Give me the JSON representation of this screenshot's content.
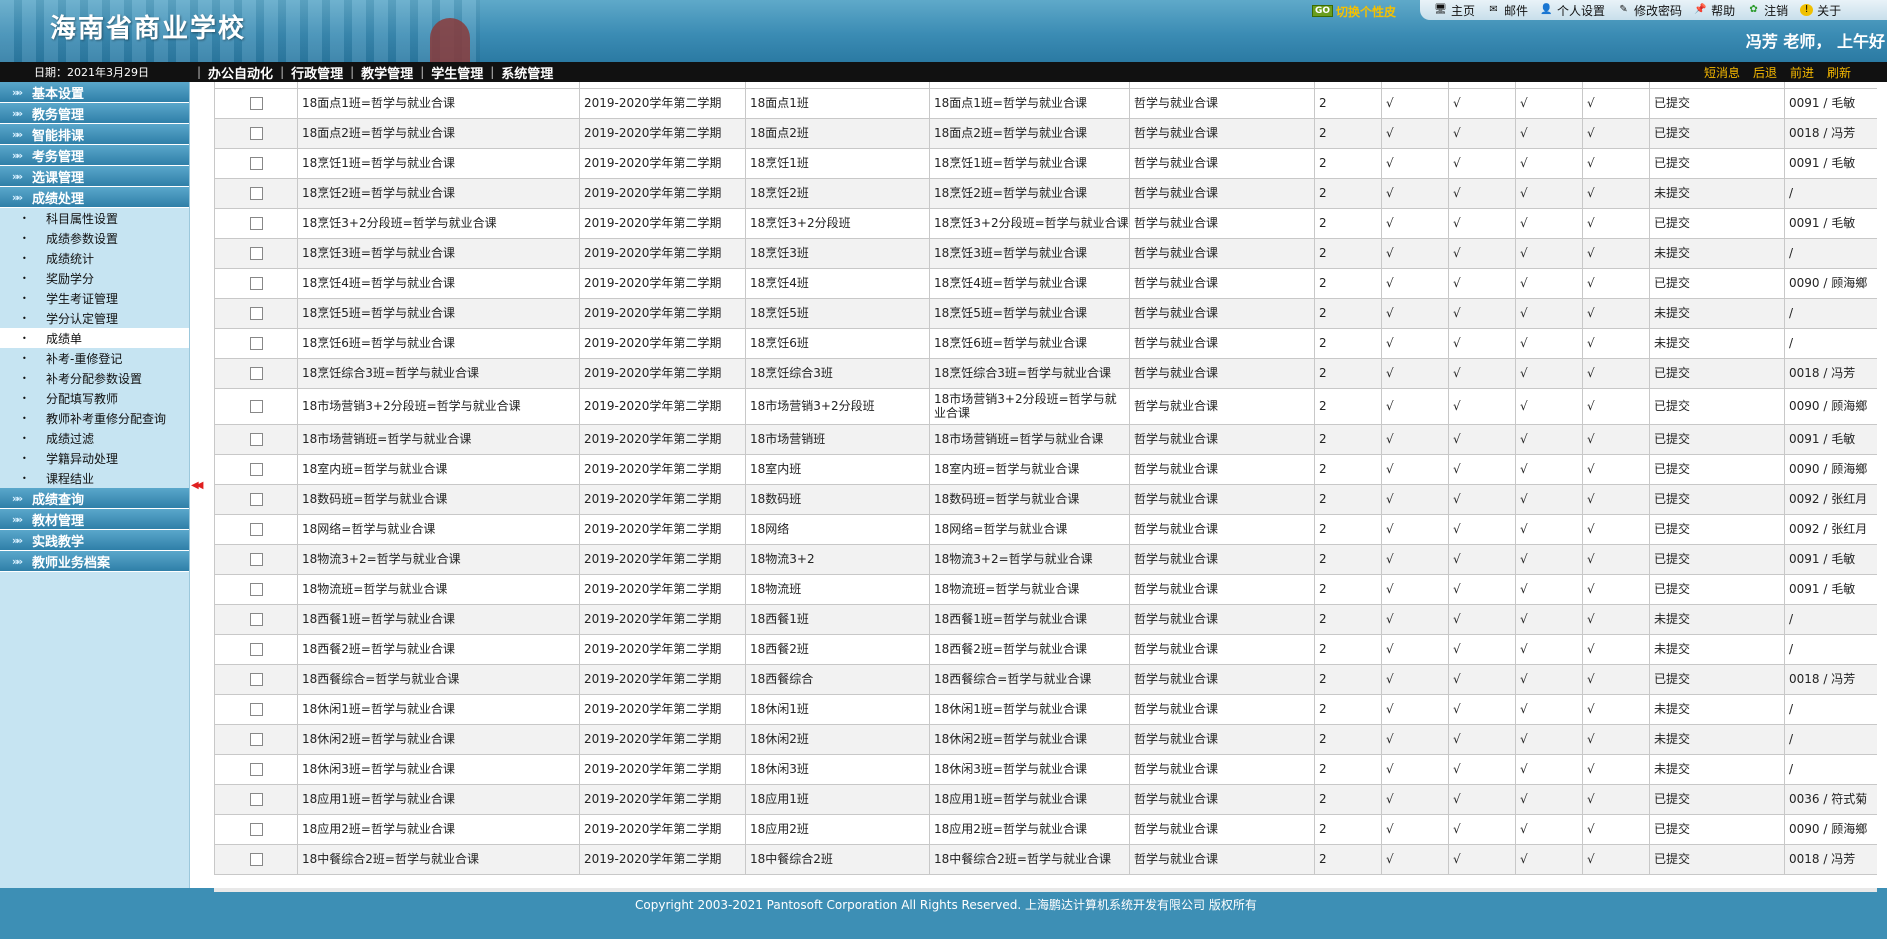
{
  "header": {
    "school_title": "海南省商业学校",
    "skin_button": "切换个性皮",
    "skin_go": "GO",
    "nav": [
      {
        "label": "主页",
        "icon": "monitor-icon"
      },
      {
        "label": "邮件",
        "icon": "mail-icon"
      },
      {
        "label": "个人设置",
        "icon": "user-icon"
      },
      {
        "label": "修改密码",
        "icon": "password-icon"
      },
      {
        "label": "帮助",
        "icon": "help-pin-icon"
      },
      {
        "label": "注销",
        "icon": "logout-icon"
      },
      {
        "label": "关于",
        "icon": "info-icon"
      }
    ],
    "greeting": "冯芳 老师， 上午好"
  },
  "menubar": {
    "date": "日期：2021年3月29日",
    "menus": [
      "办公自动化",
      "行政管理",
      "教学管理",
      "学生管理",
      "系统管理"
    ],
    "right": [
      "短消息",
      "后退",
      "前进",
      "刷新"
    ]
  },
  "sidebar": {
    "groups_top": [
      "基本设置",
      "教务管理",
      "智能排课",
      "考务管理",
      "选课管理",
      "成绩处理"
    ],
    "subitems": [
      "科目属性设置",
      "成绩参数设置",
      "成绩统计",
      "奖励学分",
      "学生考证管理",
      "学分认定管理",
      "成绩单",
      "补考-重修登记",
      "补考分配参数设置",
      "分配填写教师",
      "教师补考重修分配查询",
      "成绩过滤",
      "学籍异动处理",
      "课程结业"
    ],
    "active_subitem": "成绩单",
    "groups_bottom": [
      "成绩查询",
      "教材管理",
      "实践教学",
      "教师业务档案"
    ]
  },
  "table": {
    "rows": [
      {
        "name": "18面点1班=哲学与就业合课",
        "term": "2019-2020学年第二学期",
        "cls": "18面点1班",
        "course": "18面点1班=哲学与就业合课",
        "subject": "哲学与就业合课",
        "credit": "2",
        "m1": "√",
        "m2": "√",
        "m3": "√",
        "m4": "√",
        "status": "已提交",
        "teacher": "0091 / 毛敏"
      },
      {
        "name": "18面点2班=哲学与就业合课",
        "term": "2019-2020学年第二学期",
        "cls": "18面点2班",
        "course": "18面点2班=哲学与就业合课",
        "subject": "哲学与就业合课",
        "credit": "2",
        "m1": "√",
        "m2": "√",
        "m3": "√",
        "m4": "√",
        "status": "已提交",
        "teacher": "0018 / 冯芳"
      },
      {
        "name": "18烹饪1班=哲学与就业合课",
        "term": "2019-2020学年第二学期",
        "cls": "18烹饪1班",
        "course": "18烹饪1班=哲学与就业合课",
        "subject": "哲学与就业合课",
        "credit": "2",
        "m1": "√",
        "m2": "√",
        "m3": "√",
        "m4": "√",
        "status": "已提交",
        "teacher": "0091 / 毛敏"
      },
      {
        "name": "18烹饪2班=哲学与就业合课",
        "term": "2019-2020学年第二学期",
        "cls": "18烹饪2班",
        "course": "18烹饪2班=哲学与就业合课",
        "subject": "哲学与就业合课",
        "credit": "2",
        "m1": "√",
        "m2": "√",
        "m3": "√",
        "m4": "√",
        "status": "未提交",
        "teacher": "/"
      },
      {
        "name": "18烹饪3+2分段班=哲学与就业合课",
        "term": "2019-2020学年第二学期",
        "cls": "18烹饪3+2分段班",
        "course": "18烹饪3+2分段班=哲学与就业合课",
        "subject": "哲学与就业合课",
        "credit": "2",
        "m1": "√",
        "m2": "√",
        "m3": "√",
        "m4": "√",
        "status": "已提交",
        "teacher": "0091 / 毛敏"
      },
      {
        "name": "18烹饪3班=哲学与就业合课",
        "term": "2019-2020学年第二学期",
        "cls": "18烹饪3班",
        "course": "18烹饪3班=哲学与就业合课",
        "subject": "哲学与就业合课",
        "credit": "2",
        "m1": "√",
        "m2": "√",
        "m3": "√",
        "m4": "√",
        "status": "未提交",
        "teacher": "/"
      },
      {
        "name": "18烹饪4班=哲学与就业合课",
        "term": "2019-2020学年第二学期",
        "cls": "18烹饪4班",
        "course": "18烹饪4班=哲学与就业合课",
        "subject": "哲学与就业合课",
        "credit": "2",
        "m1": "√",
        "m2": "√",
        "m3": "√",
        "m4": "√",
        "status": "已提交",
        "teacher": "0090 / 顾海鄉"
      },
      {
        "name": "18烹饪5班=哲学与就业合课",
        "term": "2019-2020学年第二学期",
        "cls": "18烹饪5班",
        "course": "18烹饪5班=哲学与就业合课",
        "subject": "哲学与就业合课",
        "credit": "2",
        "m1": "√",
        "m2": "√",
        "m3": "√",
        "m4": "√",
        "status": "未提交",
        "teacher": "/"
      },
      {
        "name": "18烹饪6班=哲学与就业合课",
        "term": "2019-2020学年第二学期",
        "cls": "18烹饪6班",
        "course": "18烹饪6班=哲学与就业合课",
        "subject": "哲学与就业合课",
        "credit": "2",
        "m1": "√",
        "m2": "√",
        "m3": "√",
        "m4": "√",
        "status": "未提交",
        "teacher": "/"
      },
      {
        "name": "18烹饪综合3班=哲学与就业合课",
        "term": "2019-2020学年第二学期",
        "cls": "18烹饪综合3班",
        "course": "18烹饪综合3班=哲学与就业合课",
        "subject": "哲学与就业合课",
        "credit": "2",
        "m1": "√",
        "m2": "√",
        "m3": "√",
        "m4": "√",
        "status": "已提交",
        "teacher": "0018 / 冯芳"
      },
      {
        "name": "18市场营销3+2分段班=哲学与就业合课",
        "term": "2019-2020学年第二学期",
        "cls": "18市场营销3+2分段班",
        "course": "18市场营销3+2分段班=哲学与就业合课",
        "subject": "哲学与就业合课",
        "credit": "2",
        "m1": "√",
        "m2": "√",
        "m3": "√",
        "m4": "√",
        "status": "已提交",
        "teacher": "0090 / 顾海鄉",
        "tall": true
      },
      {
        "name": "18市场营销班=哲学与就业合课",
        "term": "2019-2020学年第二学期",
        "cls": "18市场营销班",
        "course": "18市场营销班=哲学与就业合课",
        "subject": "哲学与就业合课",
        "credit": "2",
        "m1": "√",
        "m2": "√",
        "m3": "√",
        "m4": "√",
        "status": "已提交",
        "teacher": "0091 / 毛敏"
      },
      {
        "name": "18室内班=哲学与就业合课",
        "term": "2019-2020学年第二学期",
        "cls": "18室内班",
        "course": "18室内班=哲学与就业合课",
        "subject": "哲学与就业合课",
        "credit": "2",
        "m1": "√",
        "m2": "√",
        "m3": "√",
        "m4": "√",
        "status": "已提交",
        "teacher": "0090 / 顾海鄉"
      },
      {
        "name": "18数码班=哲学与就业合课",
        "term": "2019-2020学年第二学期",
        "cls": "18数码班",
        "course": "18数码班=哲学与就业合课",
        "subject": "哲学与就业合课",
        "credit": "2",
        "m1": "√",
        "m2": "√",
        "m3": "√",
        "m4": "√",
        "status": "已提交",
        "teacher": "0092 / 张红月"
      },
      {
        "name": "18网络=哲学与就业合课",
        "term": "2019-2020学年第二学期",
        "cls": "18网络",
        "course": "18网络=哲学与就业合课",
        "subject": "哲学与就业合课",
        "credit": "2",
        "m1": "√",
        "m2": "√",
        "m3": "√",
        "m4": "√",
        "status": "已提交",
        "teacher": "0092 / 张红月"
      },
      {
        "name": "18物流3+2=哲学与就业合课",
        "term": "2019-2020学年第二学期",
        "cls": "18物流3+2",
        "course": "18物流3+2=哲学与就业合课",
        "subject": "哲学与就业合课",
        "credit": "2",
        "m1": "√",
        "m2": "√",
        "m3": "√",
        "m4": "√",
        "status": "已提交",
        "teacher": "0091 / 毛敏"
      },
      {
        "name": "18物流班=哲学与就业合课",
        "term": "2019-2020学年第二学期",
        "cls": "18物流班",
        "course": "18物流班=哲学与就业合课",
        "subject": "哲学与就业合课",
        "credit": "2",
        "m1": "√",
        "m2": "√",
        "m3": "√",
        "m4": "√",
        "status": "已提交",
        "teacher": "0091 / 毛敏"
      },
      {
        "name": "18西餐1班=哲学与就业合课",
        "term": "2019-2020学年第二学期",
        "cls": "18西餐1班",
        "course": "18西餐1班=哲学与就业合课",
        "subject": "哲学与就业合课",
        "credit": "2",
        "m1": "√",
        "m2": "√",
        "m3": "√",
        "m4": "√",
        "status": "未提交",
        "teacher": "/"
      },
      {
        "name": "18西餐2班=哲学与就业合课",
        "term": "2019-2020学年第二学期",
        "cls": "18西餐2班",
        "course": "18西餐2班=哲学与就业合课",
        "subject": "哲学与就业合课",
        "credit": "2",
        "m1": "√",
        "m2": "√",
        "m3": "√",
        "m4": "√",
        "status": "未提交",
        "teacher": "/"
      },
      {
        "name": "18西餐综合=哲学与就业合课",
        "term": "2019-2020学年第二学期",
        "cls": "18西餐综合",
        "course": "18西餐综合=哲学与就业合课",
        "subject": "哲学与就业合课",
        "credit": "2",
        "m1": "√",
        "m2": "√",
        "m3": "√",
        "m4": "√",
        "status": "已提交",
        "teacher": "0018 / 冯芳"
      },
      {
        "name": "18休闲1班=哲学与就业合课",
        "term": "2019-2020学年第二学期",
        "cls": "18休闲1班",
        "course": "18休闲1班=哲学与就业合课",
        "subject": "哲学与就业合课",
        "credit": "2",
        "m1": "√",
        "m2": "√",
        "m3": "√",
        "m4": "√",
        "status": "未提交",
        "teacher": "/"
      },
      {
        "name": "18休闲2班=哲学与就业合课",
        "term": "2019-2020学年第二学期",
        "cls": "18休闲2班",
        "course": "18休闲2班=哲学与就业合课",
        "subject": "哲学与就业合课",
        "credit": "2",
        "m1": "√",
        "m2": "√",
        "m3": "√",
        "m4": "√",
        "status": "未提交",
        "teacher": "/"
      },
      {
        "name": "18休闲3班=哲学与就业合课",
        "term": "2019-2020学年第二学期",
        "cls": "18休闲3班",
        "course": "18休闲3班=哲学与就业合课",
        "subject": "哲学与就业合课",
        "credit": "2",
        "m1": "√",
        "m2": "√",
        "m3": "√",
        "m4": "√",
        "status": "未提交",
        "teacher": "/"
      },
      {
        "name": "18应用1班=哲学与就业合课",
        "term": "2019-2020学年第二学期",
        "cls": "18应用1班",
        "course": "18应用1班=哲学与就业合课",
        "subject": "哲学与就业合课",
        "credit": "2",
        "m1": "√",
        "m2": "√",
        "m3": "√",
        "m4": "√",
        "status": "已提交",
        "teacher": "0036 / 符式菊"
      },
      {
        "name": "18应用2班=哲学与就业合课",
        "term": "2019-2020学年第二学期",
        "cls": "18应用2班",
        "course": "18应用2班=哲学与就业合课",
        "subject": "哲学与就业合课",
        "credit": "2",
        "m1": "√",
        "m2": "√",
        "m3": "√",
        "m4": "√",
        "status": "已提交",
        "teacher": "0090 / 顾海鄉"
      },
      {
        "name": "18中餐综合2班=哲学与就业合课",
        "term": "2019-2020学年第二学期",
        "cls": "18中餐综合2班",
        "course": "18中餐综合2班=哲学与就业合课",
        "subject": "哲学与就业合课",
        "credit": "2",
        "m1": "√",
        "m2": "√",
        "m3": "√",
        "m4": "√",
        "status": "已提交",
        "teacher": "0018 / 冯芳"
      }
    ]
  },
  "footer": {
    "copyright": "Copyright 2003-2021 Pantosoft Corporation All Rights Reserved. 上海鹏达计算机系统开发有限公司 版权所有"
  }
}
